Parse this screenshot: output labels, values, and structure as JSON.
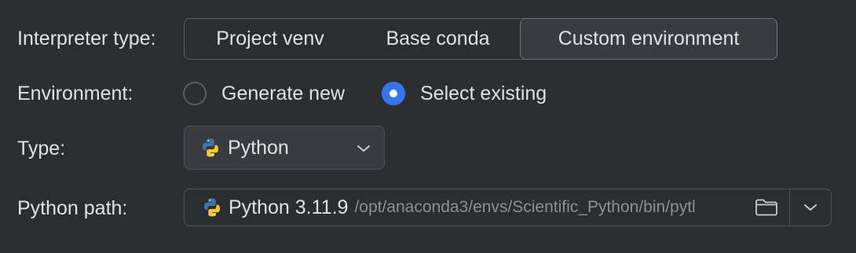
{
  "interpreter_type": {
    "label": "Interpreter type:",
    "options": [
      "Project venv",
      "Base conda",
      "Custom environment"
    ],
    "selected": "Custom environment"
  },
  "environment": {
    "label": "Environment:",
    "options": [
      "Generate new",
      "Select existing"
    ],
    "selected": "Select existing"
  },
  "type": {
    "label": "Type:",
    "value": "Python",
    "icon": "python-logo-icon"
  },
  "python_path": {
    "label": "Python path:",
    "version": "Python 3.11.9",
    "path": "/opt/anaconda3/envs/Scientific_Python/bin/pytl",
    "icon": "python-logo-icon"
  },
  "colors": {
    "background": "#2b2d30",
    "accent": "#3574f0",
    "text": "#dfe1e5",
    "muted_text": "#8c8f94",
    "python_blue": "#3b77a8",
    "python_yellow": "#f6c935"
  }
}
